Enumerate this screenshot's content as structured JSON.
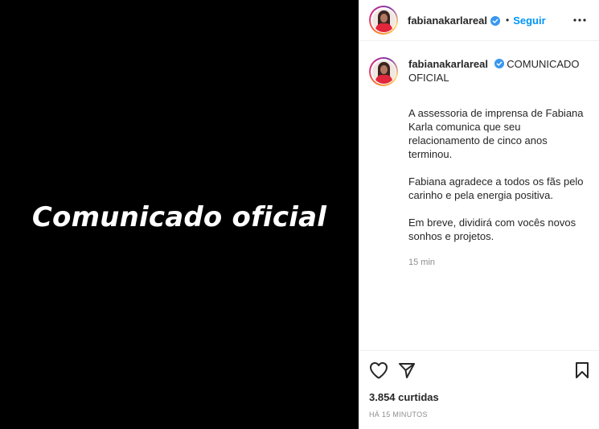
{
  "media": {
    "overlay_text": "Comunicado oficial"
  },
  "header": {
    "username": "fabianakarlareal",
    "separator": "•",
    "follow_label": "Seguir",
    "more_icon": "more-horizontal-icon"
  },
  "caption": {
    "username": "fabianakarlareal",
    "title": "COMUNICADO OFICIAL",
    "paragraphs": [
      "A assessoria de imprensa de Fabiana Karla comunica que seu relacionamento de cinco anos terminou.",
      "Fabiana agradece a todos os fãs pelo carinho e pela energia positiva.",
      "Em breve, dividirá com vocês novos sonhos e projetos."
    ],
    "time": "15 min"
  },
  "footer": {
    "icons": [
      "heart-icon",
      "share-icon",
      "bookmark-icon"
    ],
    "likes": "3.854 curtidas",
    "posted": "HÁ 15 MINUTOS"
  },
  "colors": {
    "follow": "#0095f6",
    "verified": "#3897f0",
    "muted": "#8e8e8e",
    "text": "#262626"
  }
}
